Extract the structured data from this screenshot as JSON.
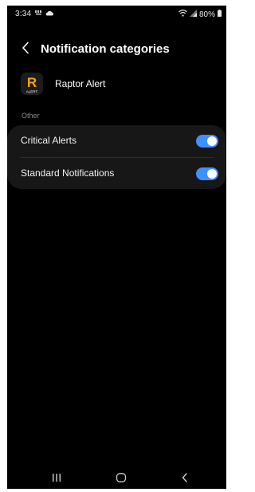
{
  "status_bar": {
    "time": "3:34",
    "battery": "80%",
    "icons": [
      "data-icon",
      "cloud-icon",
      "wifi-icon",
      "signal-icon",
      "battery-icon"
    ]
  },
  "header": {
    "back_icon": "chevron-left-icon",
    "title": "Notification categories"
  },
  "app": {
    "name": "Raptor Alert",
    "icon_letter": "R",
    "icon_caption": "ALERT"
  },
  "section": {
    "label": "Other"
  },
  "categories": [
    {
      "label": "Critical Alerts",
      "enabled": true
    },
    {
      "label": "Standard Notifications",
      "enabled": true
    }
  ],
  "navigation": {
    "buttons": [
      "recents-icon",
      "home-icon",
      "back-icon"
    ]
  },
  "colors": {
    "background": "#000000",
    "card": "#171717",
    "toggle_on": "#3e91ff",
    "app_icon_accent": "#f0a21a"
  }
}
